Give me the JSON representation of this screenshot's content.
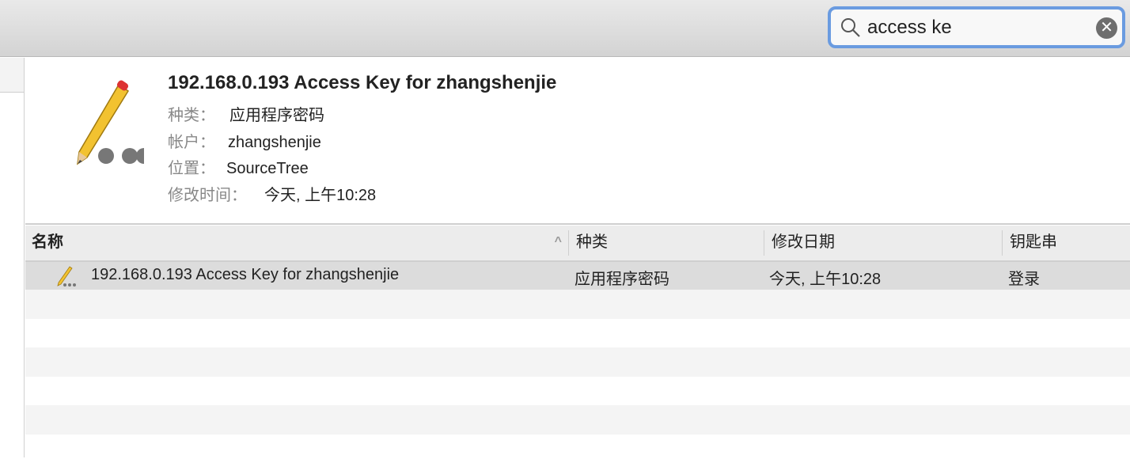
{
  "search": {
    "value": "access ke"
  },
  "item": {
    "title": "192.168.0.193 Access Key for zhangshenjie",
    "fields": [
      {
        "label": "种类：",
        "value": "应用程序密码"
      },
      {
        "label": "帐户：",
        "value": "zhangshenjie"
      },
      {
        "label": "位置：",
        "value": "SourceTree"
      },
      {
        "label": "修改时间：",
        "value": "今天, 上午10:28"
      }
    ]
  },
  "table": {
    "columns": [
      "名称",
      "种类",
      "修改日期",
      "钥匙串"
    ],
    "sort_indicator": "^",
    "rows": [
      {
        "name": "192.168.0.193 Access Key for zhangshenjie",
        "kind": "应用程序密码",
        "date": "今天, 上午10:28",
        "keychain": "登录",
        "selected": true
      }
    ]
  },
  "colors": {
    "search_focus": "#6a9be0",
    "selected_row": "#dcdcdc"
  }
}
